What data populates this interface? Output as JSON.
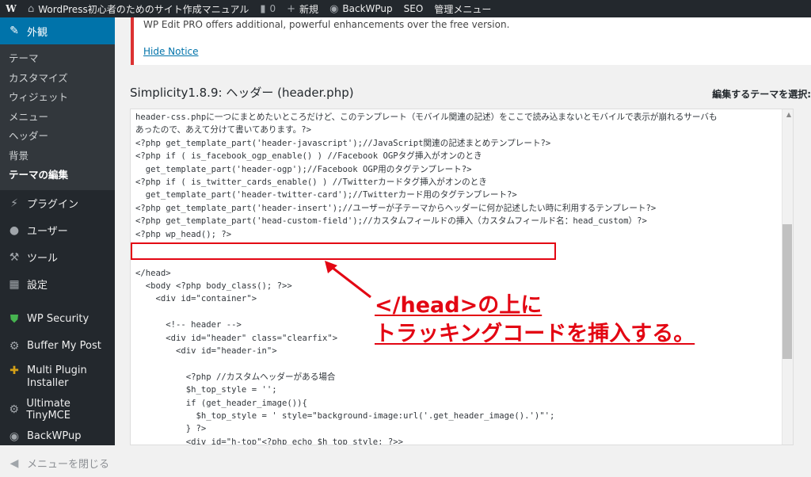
{
  "adminbar": {
    "site_name": "WordPress初心者のためのサイト作成マニュアル",
    "comments_count": "0",
    "new_label": "新規",
    "backwpup_label": "BackWPup",
    "seo_label": "SEO",
    "admin_menu_label": "管理メニュー"
  },
  "sidebar": {
    "appearance": "外観",
    "submenu": [
      "テーマ",
      "カスタマイズ",
      "ウィジェット",
      "メニュー",
      "ヘッダー",
      "背景",
      "テーマの編集"
    ],
    "plugins": "プラグイン",
    "users": "ユーザー",
    "tools": "ツール",
    "settings": "設定",
    "wp_security": "WP Security",
    "buffer": "Buffer My Post",
    "multi_plugin_line1": "Multi Plugin",
    "multi_plugin_line2": "Installer",
    "tinymce": "Ultimate TinyMCE",
    "backwpup": "BackWPup",
    "collapse": "メニューを閉じる"
  },
  "notice": {
    "message": "WP Edit PRO offers additional, powerful enhancements over the free version.",
    "hide_link": "Hide Notice"
  },
  "page": {
    "title": "Simplicity1.8.9: ヘッダー (header.php)",
    "select_theme_label": "編集するテーマを選択:"
  },
  "code_lines": [
    "header-css.phpに一つにまとめたいところだけど、このテンプレート（モバイル関連の記述）をここで読み込まないとモバイルで表示が崩れるサーバも",
    "あったので、あえて分けて書いてあります。?>",
    "<?php get_template_part('header-javascript');//JavaScript関連の記述まとめテンプレート?>",
    "<?php if ( is_facebook_ogp_enable() ) //Facebook OGPタグ挿入がオンのとき",
    "  get_template_part('header-ogp');//Facebook OGP用のタグテンプレート?>",
    "<?php if ( is_twitter_cards_enable() ) //Twitterカードタグ挿入がオンのとき",
    "  get_template_part('header-twitter-card');//Twitterカード用のタグテンプレート?>",
    "<?php get_template_part('header-insert');//ユーザーが子テーマからヘッダーに何か記述したい時に利用するテンプレート?>",
    "<?php get_template_part('head-custom-field');//カスタムフィールドの挿入（カスタムフィールド名：head_custom）?>",
    "<?php wp_head(); ?>",
    "",
    "",
    "</head>",
    "  <body <?php body_class(); ?>>",
    "    <div id=\"container\">",
    "",
    "      <!-- header -->",
    "      <div id=\"header\" class=\"clearfix\">",
    "        <div id=\"header-in\">",
    "",
    "          <?php //カスタムヘッダーがある場合",
    "          $h_top_style = '';",
    "          if (get_header_image()){",
    "            $h_top_style = ' style=\"background-image:url('.get_header_image().')\"';",
    "          } ?>",
    "          <div id=\"h-top\"<?php echo $h_top_style; ?>>"
  ],
  "annotation": {
    "line1": "</head>の上に",
    "line2": "トラッキングコードを挿入する。",
    "color": "#e30613"
  },
  "colors": {
    "admin_bar_bg": "#23282d",
    "sidebar_active": "#0073aa",
    "link": "#0073aa",
    "notice_border": "#dc3232"
  }
}
